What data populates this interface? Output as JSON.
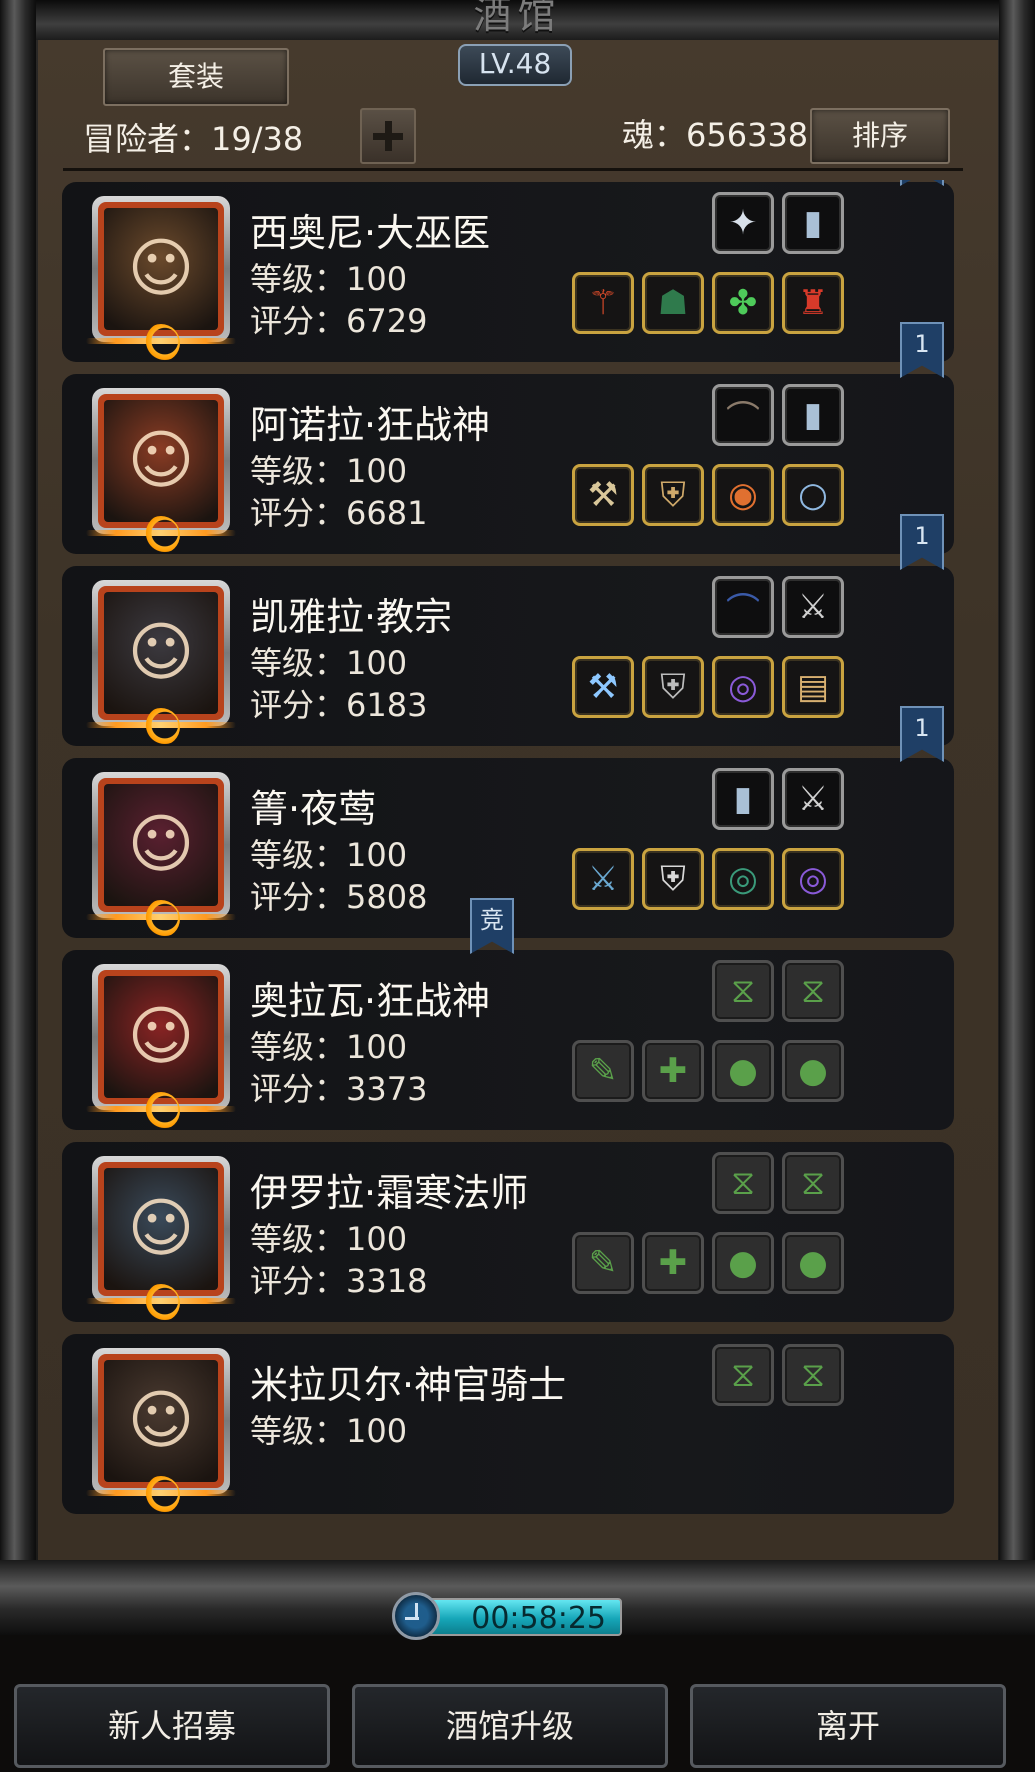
{
  "header": {
    "title": "酒馆",
    "level_badge": "LV.48",
    "suit_button": "套装",
    "adventurer_label": "冒险者：19/38",
    "soul_label": "魂：656338",
    "sort_button": "排序"
  },
  "heroes": [
    {
      "name": "西奥尼·大巫医",
      "level": "等级：100",
      "score": "评分：6729",
      "rank": "1",
      "portrait_color": "#6b4a2c",
      "top_slots": [
        {
          "icon": "sigil-icon",
          "style": "silver"
        },
        {
          "icon": "book-icon",
          "style": "silver"
        }
      ],
      "bottom_slots": [
        {
          "icon": "staff-icon",
          "style": "gold"
        },
        {
          "icon": "cloak-icon",
          "style": "gold"
        },
        {
          "icon": "gem-icon",
          "style": "gold"
        },
        {
          "icon": "robe-icon",
          "style": "gold"
        }
      ]
    },
    {
      "name": "阿诺拉·狂战神",
      "level": "等级：100",
      "score": "评分：6681",
      "rank": "1",
      "portrait_color": "#8a3c24",
      "top_slots": [
        {
          "icon": "bracer-icon",
          "style": "silver"
        },
        {
          "icon": "book-icon",
          "style": "silver"
        }
      ],
      "bottom_slots": [
        {
          "icon": "axe-icon",
          "style": "gold"
        },
        {
          "icon": "armor-icon",
          "style": "gold"
        },
        {
          "icon": "amulet-icon",
          "style": "gold"
        },
        {
          "icon": "ring-icon",
          "style": "gold"
        }
      ]
    },
    {
      "name": "凯雅拉·教宗",
      "level": "等级：100",
      "score": "评分：6183",
      "rank": "1",
      "portrait_color": "#3c3a40",
      "top_slots": [
        {
          "icon": "bow-icon",
          "style": "silver"
        },
        {
          "icon": "dagger-icon",
          "style": "silver"
        }
      ],
      "bottom_slots": [
        {
          "icon": "hammer-icon",
          "style": "gold"
        },
        {
          "icon": "coat-icon",
          "style": "gold"
        },
        {
          "icon": "bangle-icon",
          "style": "gold"
        },
        {
          "icon": "scroll-icon",
          "style": "gold"
        }
      ]
    },
    {
      "name": "箐·夜莺",
      "level": "等级：100",
      "score": "评分：5808",
      "rank": "1",
      "portrait_color": "#5a2030",
      "top_slots": [
        {
          "icon": "book-icon",
          "style": "silver"
        },
        {
          "icon": "dagger-icon",
          "style": "silver"
        }
      ],
      "bottom_slots": [
        {
          "icon": "sword-icon",
          "style": "gold"
        },
        {
          "icon": "vest-icon",
          "style": "gold"
        },
        {
          "icon": "bracelet-icon",
          "style": "gold"
        },
        {
          "icon": "bangle-icon",
          "style": "gold"
        }
      ]
    },
    {
      "name": "奥拉瓦·狂战神",
      "level": "等级：100",
      "score": "评分：3373",
      "rank": "竞",
      "portrait_color": "#8a2424",
      "top_slots": [
        {
          "icon": "empty-slot-icon",
          "style": "empty"
        },
        {
          "icon": "empty-slot-icon",
          "style": "empty"
        }
      ],
      "bottom_slots": [
        {
          "icon": "empty-weapon-icon",
          "style": "empty"
        },
        {
          "icon": "empty-armor-icon",
          "style": "empty"
        },
        {
          "icon": "empty-ring-icon",
          "style": "empty"
        },
        {
          "icon": "empty-ring-icon",
          "style": "empty"
        }
      ]
    },
    {
      "name": "伊罗拉·霜寒法师",
      "level": "等级：100",
      "score": "评分：3318",
      "rank": "",
      "portrait_color": "#3a4a5a",
      "top_slots": [
        {
          "icon": "empty-slot-icon",
          "style": "empty"
        },
        {
          "icon": "empty-slot-icon",
          "style": "empty"
        }
      ],
      "bottom_slots": [
        {
          "icon": "empty-weapon-icon",
          "style": "empty"
        },
        {
          "icon": "empty-armor-icon",
          "style": "empty"
        },
        {
          "icon": "empty-ring-icon",
          "style": "empty"
        },
        {
          "icon": "empty-ring-icon",
          "style": "empty"
        }
      ]
    },
    {
      "name": "米拉贝尔·神官骑士",
      "level": "等级：100",
      "score": "",
      "rank": "",
      "portrait_color": "#4a3a30",
      "top_slots": [
        {
          "icon": "empty-slot-icon",
          "style": "empty"
        },
        {
          "icon": "empty-slot-icon",
          "style": "empty"
        }
      ],
      "bottom_slots": []
    }
  ],
  "timer": "00:58:25",
  "footer": {
    "recruit_button": "新人招募",
    "upgrade_button": "酒馆升级",
    "leave_button": "离开"
  }
}
